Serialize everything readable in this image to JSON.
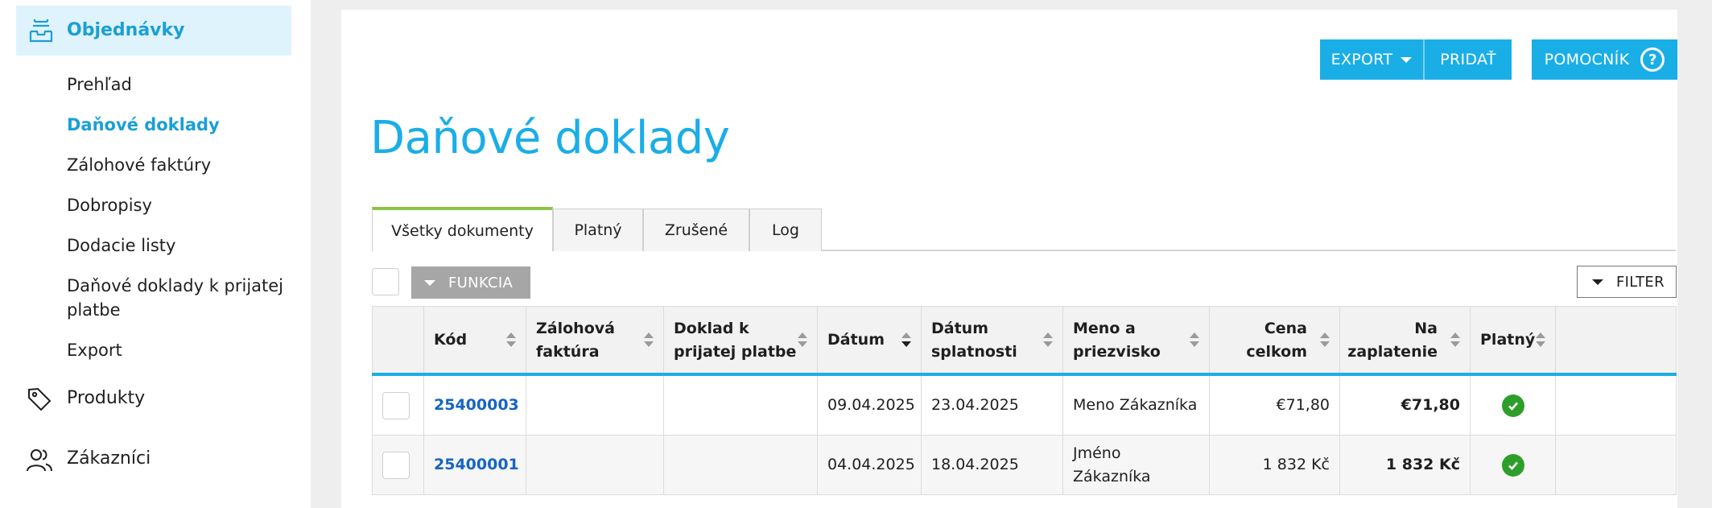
{
  "sidebar": {
    "active_section": "Objednávky",
    "sub_items": [
      "Prehľad",
      "Daňové doklady",
      "Zálohové faktúry",
      "Dobropisy",
      "Dodacie listy",
      "Daňové doklady k prijatej",
      "platbe",
      "Export"
    ],
    "products": "Produkty",
    "customers": "Zákazníci"
  },
  "toolbar": {
    "export_label": "EXPORT",
    "add_label": "PRIDAŤ",
    "helper_label": "POMOCNÍK",
    "helper_glyph": "?"
  },
  "page": {
    "title": "Daňové doklady"
  },
  "tabs": [
    "Všetky dokumenty",
    "Platný",
    "Zrušené",
    "Log"
  ],
  "actions": {
    "function_label": "FUNKCIA",
    "filter_label": "FILTER"
  },
  "table": {
    "headers": {
      "code": "Kód",
      "advance_1": "Zálohová",
      "advance_2": "faktúra",
      "receipt_1": "Doklad k",
      "receipt_2": "prijatej platbe",
      "date": "Dátum",
      "due_1": "Dátum",
      "due_2": "splatnosti",
      "name_1": "Meno a",
      "name_2": "priezvisko",
      "total_1": "Cena",
      "total_2": "celkom",
      "topay_1": "Na",
      "topay_2": "zaplatenie",
      "valid": "Platný"
    },
    "rows": [
      {
        "code": "25400003",
        "advance": "",
        "receipt": "",
        "date": "09.04.2025",
        "due": "23.04.2025",
        "name_1": "Meno Zákazníka",
        "name_2": "",
        "total": "€71,80",
        "to_pay": "€71,80",
        "valid": true
      },
      {
        "code": "25400001",
        "advance": "",
        "receipt": "",
        "date": "04.04.2025",
        "due": "18.04.2025",
        "name_1": "Jméno",
        "name_2": "Zákazníka",
        "total": "1 832 Kč",
        "to_pay": "1 832 Kč",
        "valid": true
      }
    ]
  },
  "colors": {
    "accent": "#1aaee6",
    "active_tab_marker": "#8bc34a",
    "valid_check": "#2e9e2a",
    "link": "#1565c0"
  }
}
